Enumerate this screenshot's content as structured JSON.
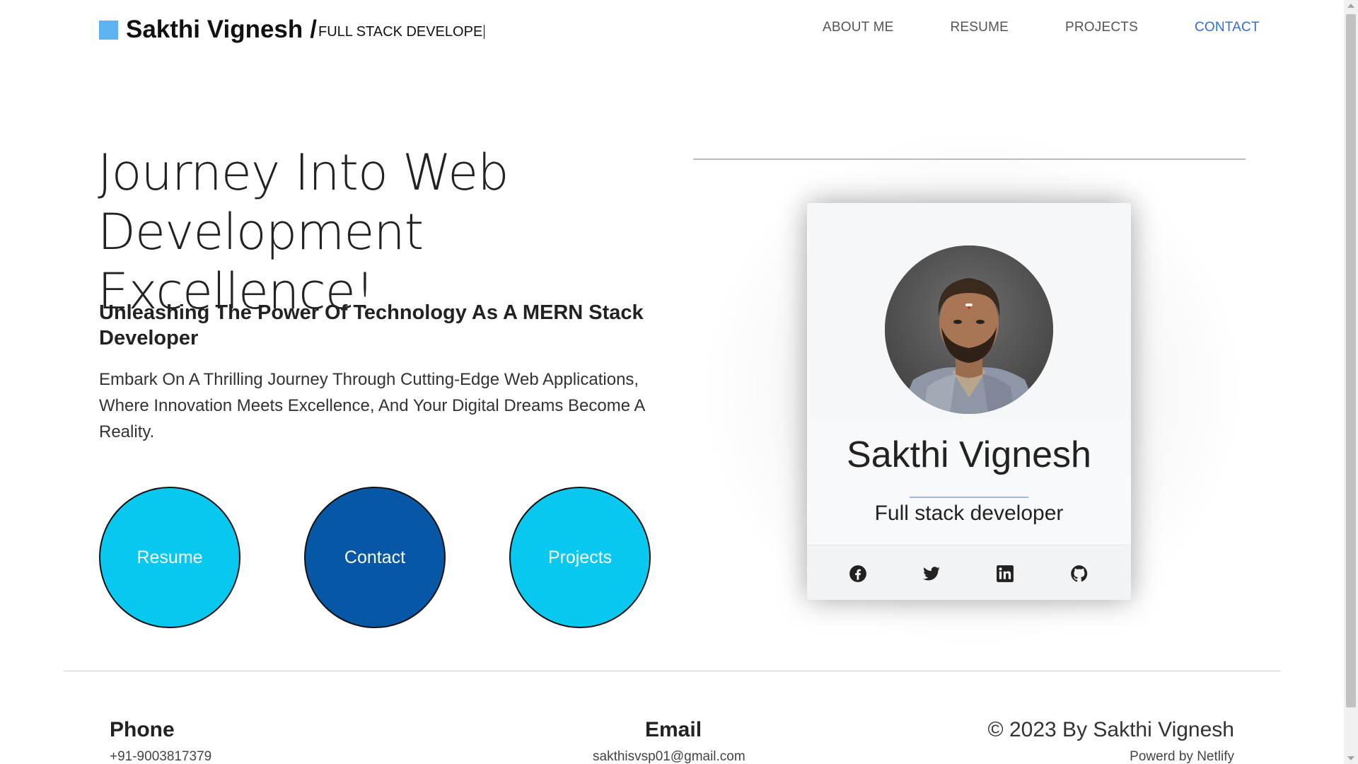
{
  "brand": {
    "name": "Sakthi Vignesh",
    "slash": "/",
    "role_typing": "FULL STACK DEVELOPE"
  },
  "nav": {
    "items": [
      {
        "label": "ABOUT ME"
      },
      {
        "label": "RESUME"
      },
      {
        "label": "PROJECTS"
      },
      {
        "label": "CONTACT"
      }
    ]
  },
  "hero": {
    "title_line1": "Journey Into Web",
    "title_line2": "Development Excellence!",
    "subtitle": "Unleashing The Power Of Technology As A MERN Stack Developer",
    "description": "Embark On A Thrilling Journey Through Cutting-Edge Web Applications, Where Innovation Meets Excellence, And Your Digital Dreams Become A Reality.",
    "buttons": [
      {
        "label": "Resume"
      },
      {
        "label": "Contact"
      },
      {
        "label": "Projects"
      }
    ]
  },
  "card": {
    "name": "Sakthi Vignesh",
    "role": "Full stack developer",
    "social": [
      "facebook-icon",
      "twitter-icon",
      "linkedin-icon",
      "github-icon"
    ]
  },
  "footer": {
    "phone_heading": "Phone",
    "phone_value": "+91-9003817379",
    "email_heading": "Email",
    "email_value": "sakthisvsp01@gmail.com",
    "copyright": "© 2023 By Sakthi Vignesh",
    "powered": "Powerd by Netlify"
  },
  "colors": {
    "brand_square": "#5cb3f0",
    "nav_active": "#2f6fd6",
    "button_cyan": "#08c8ef",
    "button_blue": "#0658a6"
  }
}
